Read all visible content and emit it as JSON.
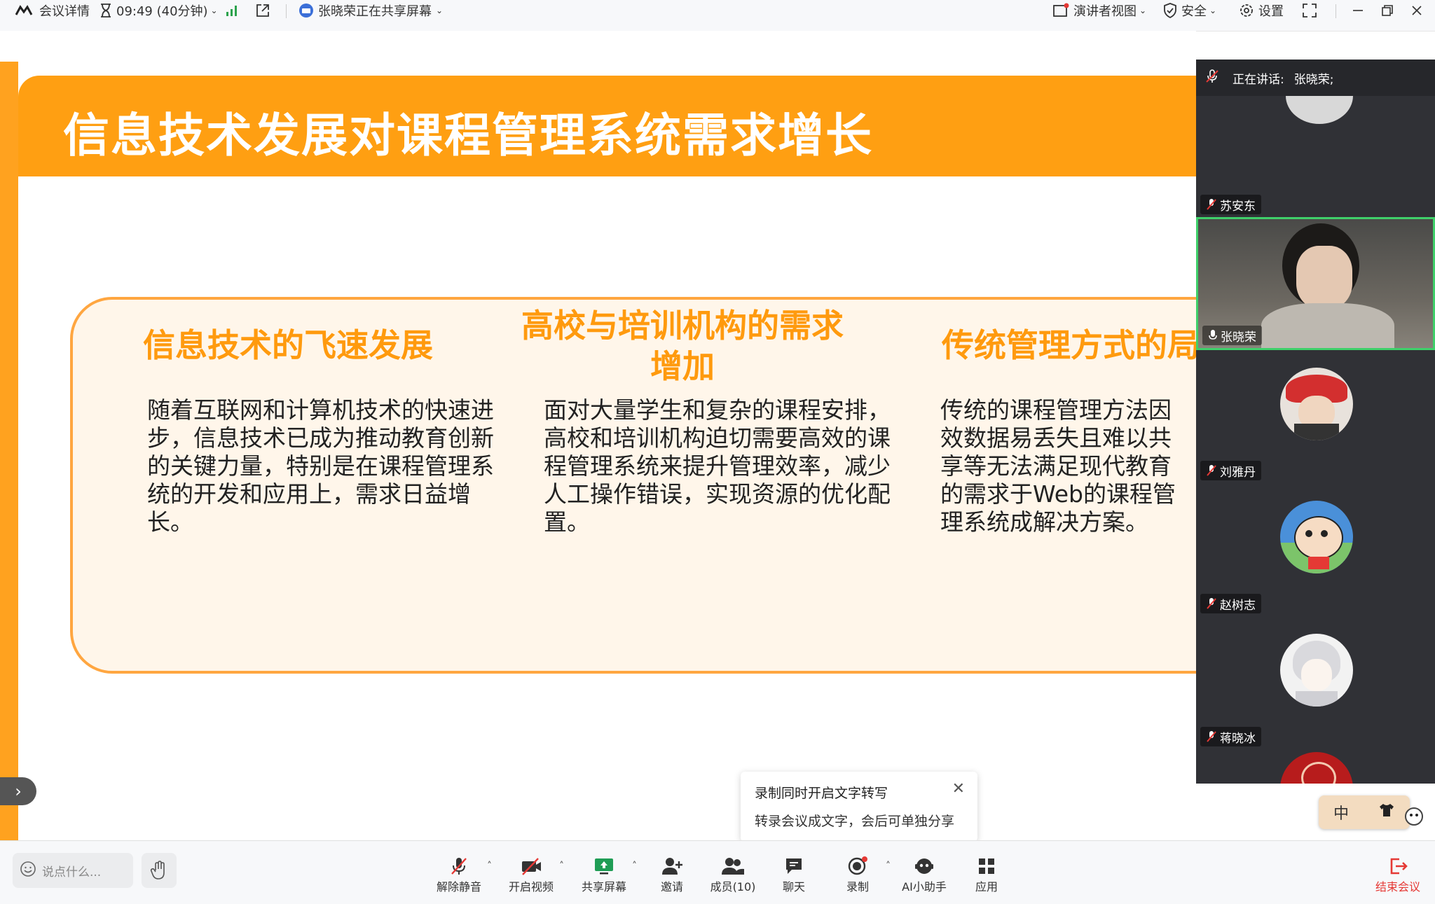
{
  "topbar": {
    "meeting_details": "会议详情",
    "duration": "09:49 (40分钟)",
    "sharing_status": "张晓荣正在共享屏幕",
    "speaker_view": "演讲者视图",
    "security": "安全",
    "settings": "设置"
  },
  "slide": {
    "title": "信息技术发展对课程管理系统需求增长",
    "columns": [
      {
        "heading": "信息技术的飞速发展",
        "body": "随着互联网和计算机技术的快速进步，信息技术已成为推动教育创新的关键力量，特别是在课程管理系统的开发和应用上，需求日益增长。"
      },
      {
        "heading_line1": "高校与培训机构的需求",
        "heading_line2": "增加",
        "body": "面对大量学生和复杂的课程安排，高校和培训机构迫切需要高效的课程管理系统来提升管理效率，减少人工操作错误，实现资源的优化配置。"
      },
      {
        "heading": "传统管理方式的局",
        "body": "传统的课程管理方法因效数据易丢失且难以共享等无法满足现代教育的需求于Web的课程管理系统成解决方案。"
      }
    ]
  },
  "panel": {
    "speaking_label": "正在讲话:",
    "speaking_name": "张晓荣;",
    "participants": [
      {
        "name": "苏安东",
        "muted": true
      },
      {
        "name": "张晓荣",
        "muted": false
      },
      {
        "name": "刘雅丹",
        "muted": true
      },
      {
        "name": "赵树志",
        "muted": true
      },
      {
        "name": "蒋晓冰",
        "muted": true
      }
    ]
  },
  "popup": {
    "title": "录制同时开启文字转写",
    "subtitle": "转录会议成文字，会后可单独分享"
  },
  "ime": {
    "mode": "中"
  },
  "bottombar": {
    "chat_placeholder": "说点什么...",
    "tools": {
      "unmute": "解除静音",
      "video": "开启视频",
      "share": "共享屏幕",
      "invite": "邀请",
      "members": "成员(10)",
      "chat": "聊天",
      "record": "录制",
      "ai": "AI小助手",
      "apps": "应用"
    },
    "end": "结束会议"
  },
  "colors": {
    "accent_orange": "#ff9f12",
    "end_red": "#e53935",
    "active_green": "#3fd06a"
  }
}
